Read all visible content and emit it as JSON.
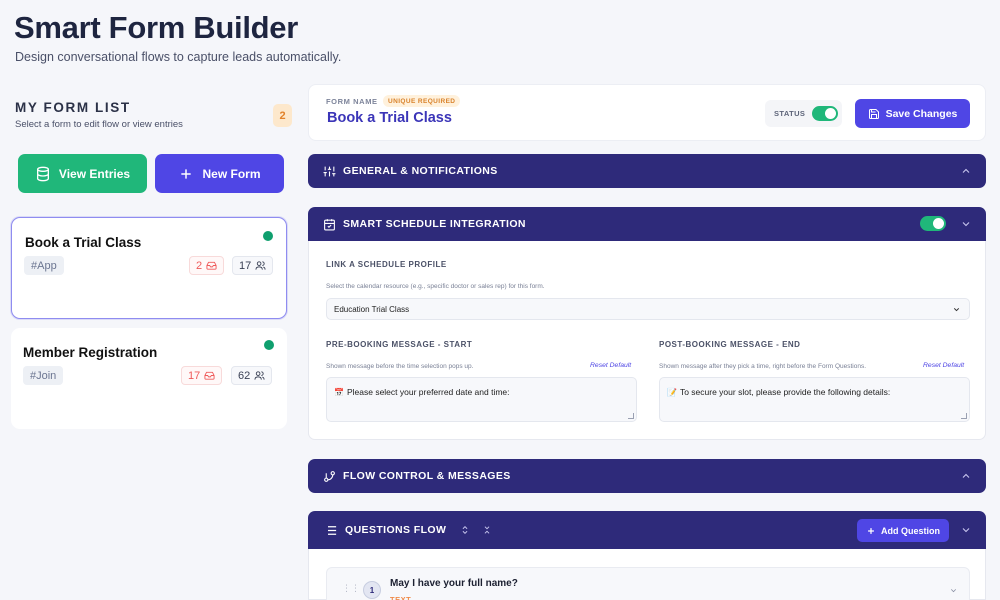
{
  "page": {
    "title": "Smart Form Builder",
    "subtitle": "Design conversational flows to capture leads automatically."
  },
  "form_list": {
    "title": "MY FORM LIST",
    "subtitle": "Select a form to edit flow or view entries",
    "count": "2",
    "view_entries_label": "View Entries",
    "new_form_label": "New Form",
    "forms": [
      {
        "name": "Book a Trial Class",
        "tag": "#App",
        "inbox_count": "2",
        "users_count": "17",
        "active": true,
        "selected": true
      },
      {
        "name": "Member Registration",
        "tag": "#Join",
        "inbox_count": "17",
        "users_count": "62",
        "active": true,
        "selected": false
      }
    ]
  },
  "editor": {
    "form_name_label": "FORM NAME",
    "unique_badge": "UNIQUE REQUIRED",
    "form_name": "Book a Trial Class",
    "status_label": "STATUS",
    "status_on": true,
    "save_label": "Save Changes",
    "sections": {
      "general": "GENERAL & NOTIFICATIONS",
      "schedule": "SMART SCHEDULE INTEGRATION",
      "flow": "FLOW CONTROL & MESSAGES",
      "questions": "QUESTIONS FLOW"
    },
    "schedule": {
      "enabled": true,
      "profile_label": "LINK A SCHEDULE PROFILE",
      "profile_help": "Select the calendar resource (e.g., specific doctor or sales rep) for this form.",
      "profile_value": "Education Trial Class",
      "pre_label": "PRE-BOOKING MESSAGE - START",
      "pre_help": "Shown message before the time selection pops up.",
      "pre_reset": "Reset Default",
      "pre_value": "Please select your preferred date and time:",
      "pre_emoji": "📅",
      "post_label": "POST-BOOKING MESSAGE - END",
      "post_help": "Shown message after they pick a time, right before the Form Questions.",
      "post_reset": "Reset Default",
      "post_value": "To secure your slot, please provide the following details:",
      "post_emoji": "📝"
    },
    "questions": {
      "add_label": "Add Question",
      "items": [
        {
          "number": "1",
          "text": "May I have your full name?",
          "type": "TEXT"
        }
      ]
    }
  },
  "colors": {
    "primary": "#4f46e5",
    "section_bar": "#2e2a7a",
    "success": "#20b77a",
    "accent_orange": "#e2822a"
  }
}
